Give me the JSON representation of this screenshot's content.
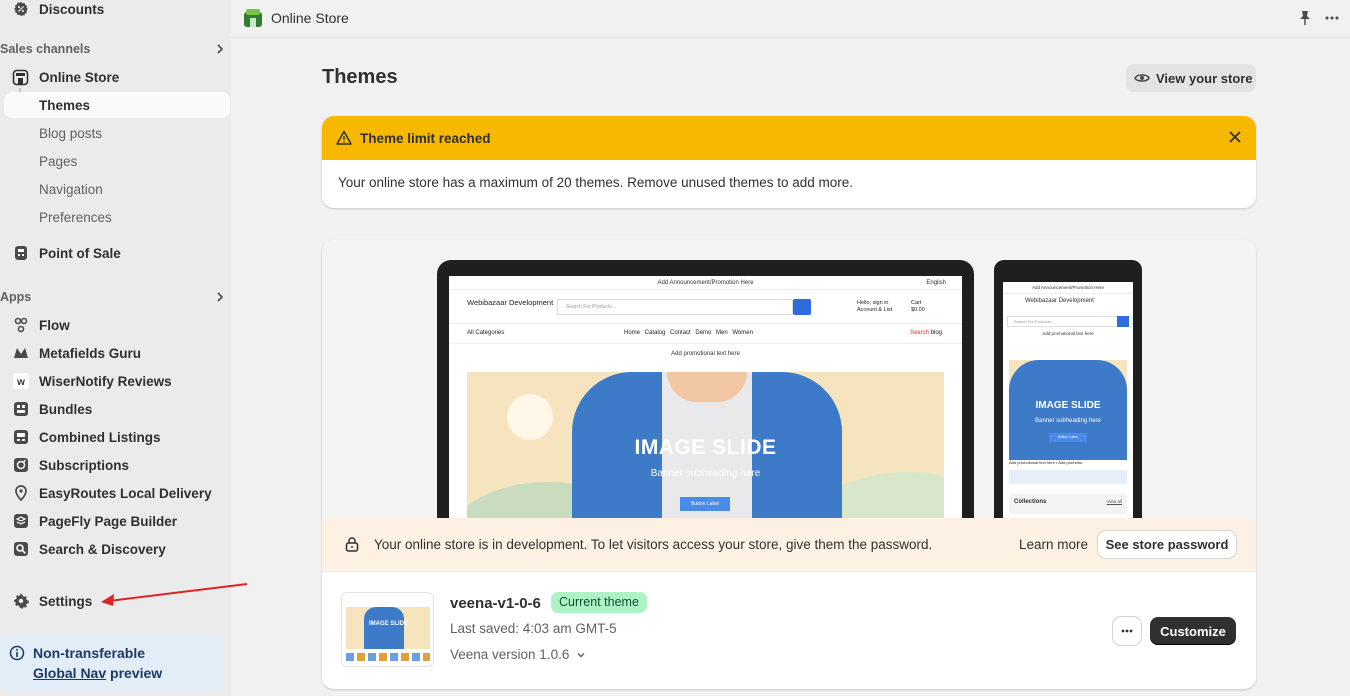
{
  "sidebar": {
    "discounts_label": "Discounts",
    "sales_channels_label": "Sales channels",
    "online_store_label": "Online Store",
    "online_store_sub": [
      {
        "label": "Themes",
        "active": true
      },
      {
        "label": "Blog posts"
      },
      {
        "label": "Pages"
      },
      {
        "label": "Navigation"
      },
      {
        "label": "Preferences"
      }
    ],
    "pos_label": "Point of Sale",
    "apps_label": "Apps",
    "apps": [
      {
        "label": "Flow",
        "icon": "flow-icon"
      },
      {
        "label": "Metafields Guru",
        "icon": "metafields-guru-icon"
      },
      {
        "label": "WiserNotify Reviews",
        "icon": "wisernotify-icon"
      },
      {
        "label": "Bundles",
        "icon": "bundles-icon"
      },
      {
        "label": "Combined Listings",
        "icon": "combined-listings-icon"
      },
      {
        "label": "Subscriptions",
        "icon": "subscriptions-icon"
      },
      {
        "label": "EasyRoutes Local Delivery",
        "icon": "easyroutes-icon"
      },
      {
        "label": "PageFly Page Builder",
        "icon": "pagefly-icon"
      },
      {
        "label": "Search & Discovery",
        "icon": "search-discovery-icon"
      }
    ],
    "settings_label": "Settings",
    "notice": {
      "line1": "Non-transferable",
      "link": "Global Nav",
      "line2_rest": " preview"
    }
  },
  "topbar": {
    "title": "Online Store"
  },
  "main": {
    "page_title": "Themes",
    "view_store_label": "View your store",
    "banner": {
      "title": "Theme limit reached",
      "message": "Your online store has a maximum of 20 themes. Remove unused themes to add more."
    },
    "preview": {
      "announcement": "Add Announcement/Promotion Here",
      "language": "English",
      "brand": "Webibazaar Development",
      "search_placeholder": "Search For Products...",
      "account": "Hello, sign in",
      "account2": "Account & List",
      "cart": "Cart",
      "cart_amount": "$0.00",
      "all_categories": "All Categories",
      "menu": "Home Catalog Contact Demo Men Women",
      "search_link": "Search",
      "blog_link": "blog",
      "promo": "Add promotional text here",
      "hero_title": "IMAGE SLIDE",
      "hero_sub": "Banner subheading here",
      "hero_button": "Button Label",
      "phone_promo": "Add promotional text here",
      "phone_strip": "Add promotional text here",
      "phone_strip2": "Add promotio",
      "collections": "Collections",
      "view_all": "View all"
    },
    "dev_notice": {
      "message": "Your online store is in development. To let visitors access your store, give them the password.",
      "learn_more": "Learn more",
      "password_button": "See store password"
    },
    "theme": {
      "name": "veena-v1-0-6",
      "badge": "Current theme",
      "last_saved": "Last saved: 4:03 am GMT-5",
      "version": "Veena version 1.0.6",
      "customize_label": "Customize"
    }
  },
  "colors": {
    "warning": "#f9b800",
    "badge_bg": "#aff2c5",
    "primary_button": "#303030",
    "annotation_arrow": "#e02424"
  }
}
